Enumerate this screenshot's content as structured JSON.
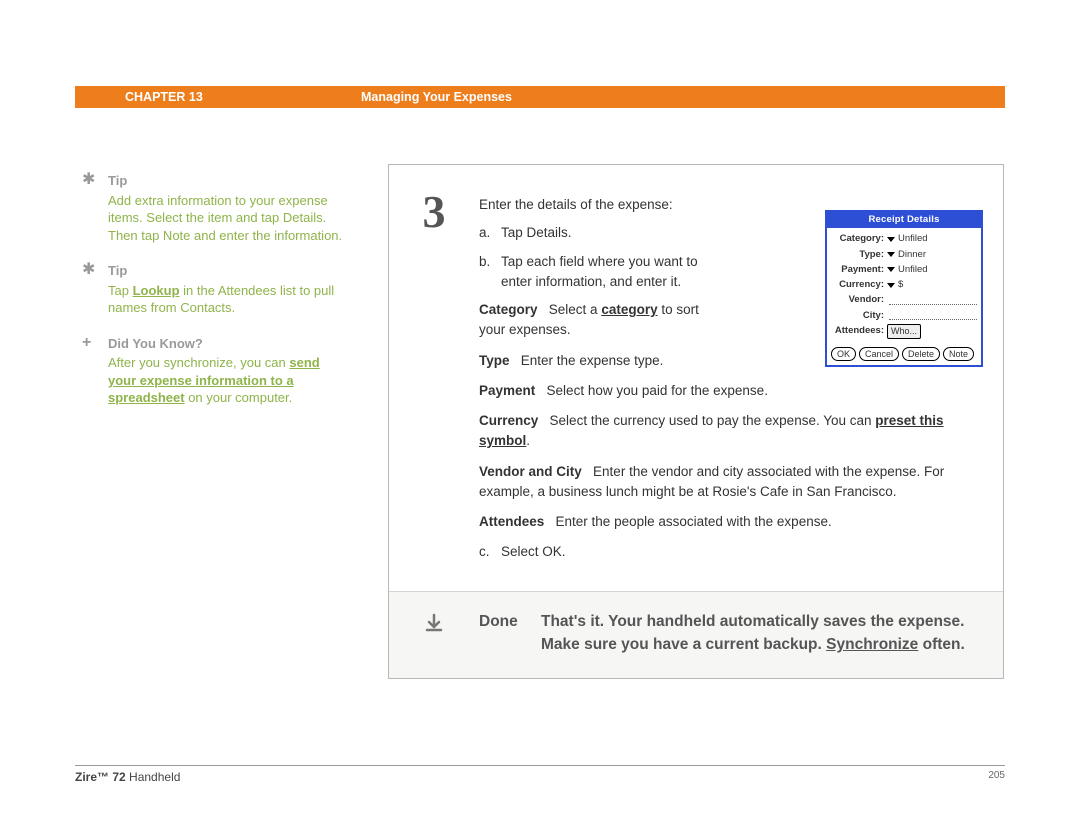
{
  "header": {
    "chapter": "CHAPTER 13",
    "title": "Managing Your Expenses"
  },
  "sidebar": {
    "tip1": {
      "label": "Tip",
      "body_a": "Add extra information to your expense items. Select the item and tap Details. Then tap Note and enter the information."
    },
    "tip2": {
      "label": "Tip",
      "body_a": "Tap ",
      "link": "Lookup",
      "body_b": " in the Attendees list to pull names from Contacts."
    },
    "dyk": {
      "label": "Did You Know?",
      "body_a": "After you synchronize, you can ",
      "link": "send your expense information to a spreadsheet",
      "body_b": " on your computer."
    }
  },
  "step": {
    "num": "3",
    "intro": "Enter the details of the expense:",
    "a_m": "a.",
    "a": "Tap Details.",
    "b_m": "b.",
    "b": "Tap each field where you want to enter information, and enter it.",
    "cat_n": "Category",
    "cat_pre": "Select a ",
    "cat_link": "category",
    "cat_post": " to sort your expenses.",
    "type_n": "Type",
    "type_t": "Enter the expense type.",
    "pay_n": "Payment",
    "pay_t": "Select how you paid for the expense.",
    "cur_n": "Currency",
    "cur_pre": "Select the currency used to pay the expense. You can ",
    "cur_link": "preset this symbol",
    "cur_post": ".",
    "vc_n": "Vendor and City",
    "vc_t": "Enter the vendor and city associated with the expense. For example, a business lunch might be at Rosie's Cafe in San Francisco.",
    "att_n": "Attendees",
    "att_t": "Enter the people associated with the expense.",
    "c_m": "c.",
    "c": "Select OK."
  },
  "done": {
    "label": "Done",
    "pre": "That's it. Your handheld automatically saves the expense. Make sure you have a current backup. ",
    "link": "Synchronize",
    "post": " often."
  },
  "inset": {
    "title": "Receipt Details",
    "labels": {
      "cat": "Category:",
      "type": "Type:",
      "pay": "Payment:",
      "cur": "Currency:",
      "ven": "Vendor:",
      "city": "City:",
      "att": "Attendees:"
    },
    "vals": {
      "cat": "Unfiled",
      "type": "Dinner",
      "pay": "Unfiled",
      "cur": "$",
      "who": "Who..."
    },
    "btns": {
      "ok": "OK",
      "cancel": "Cancel",
      "delete": "Delete",
      "note": "Note"
    }
  },
  "footer": {
    "left_bold": "Zire™ 72",
    "left_rest": " Handheld",
    "page": "205"
  }
}
